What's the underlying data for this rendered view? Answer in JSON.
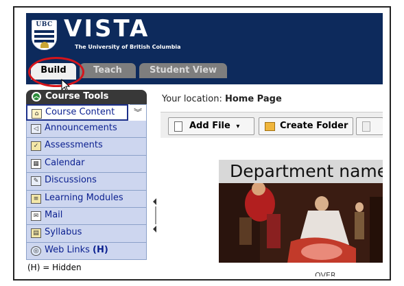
{
  "header": {
    "logo_text": "UBC",
    "app_name": "VISTA",
    "subtitle": "The University of British Columbia"
  },
  "tabs": [
    {
      "label": "Build",
      "active": true
    },
    {
      "label": "Teach",
      "active": false
    },
    {
      "label": "Student View",
      "active": false
    }
  ],
  "course_tools": {
    "title": "Course Tools",
    "items": [
      {
        "label": "Course Content",
        "icon": "home-icon",
        "active": true
      },
      {
        "label": "Announcements",
        "icon": "megaphone-icon"
      },
      {
        "label": "Assessments",
        "icon": "assessment-icon"
      },
      {
        "label": "Calendar",
        "icon": "calendar-icon"
      },
      {
        "label": "Discussions",
        "icon": "pin-icon"
      },
      {
        "label": "Learning Modules",
        "icon": "module-icon"
      },
      {
        "label": "Mail",
        "icon": "envelope-icon"
      },
      {
        "label": "Syllabus",
        "icon": "syllabus-icon"
      },
      {
        "label": "Web Links",
        "icon": "globe-icon",
        "suffix": "(H)"
      }
    ],
    "hidden_note": "(H) = Hidden"
  },
  "main": {
    "location_label": "Your location:",
    "location_value": "Home Page",
    "toolbar": {
      "add_file_label": "Add File",
      "create_folder_label": "Create Folder"
    },
    "banner_title": "Department name",
    "caption": "OVER"
  },
  "colors": {
    "header_bg": "#0d2a5c",
    "tool_bg": "#cdd6ef",
    "tool_text": "#0a1f8f",
    "highlight": "#d6151b"
  }
}
